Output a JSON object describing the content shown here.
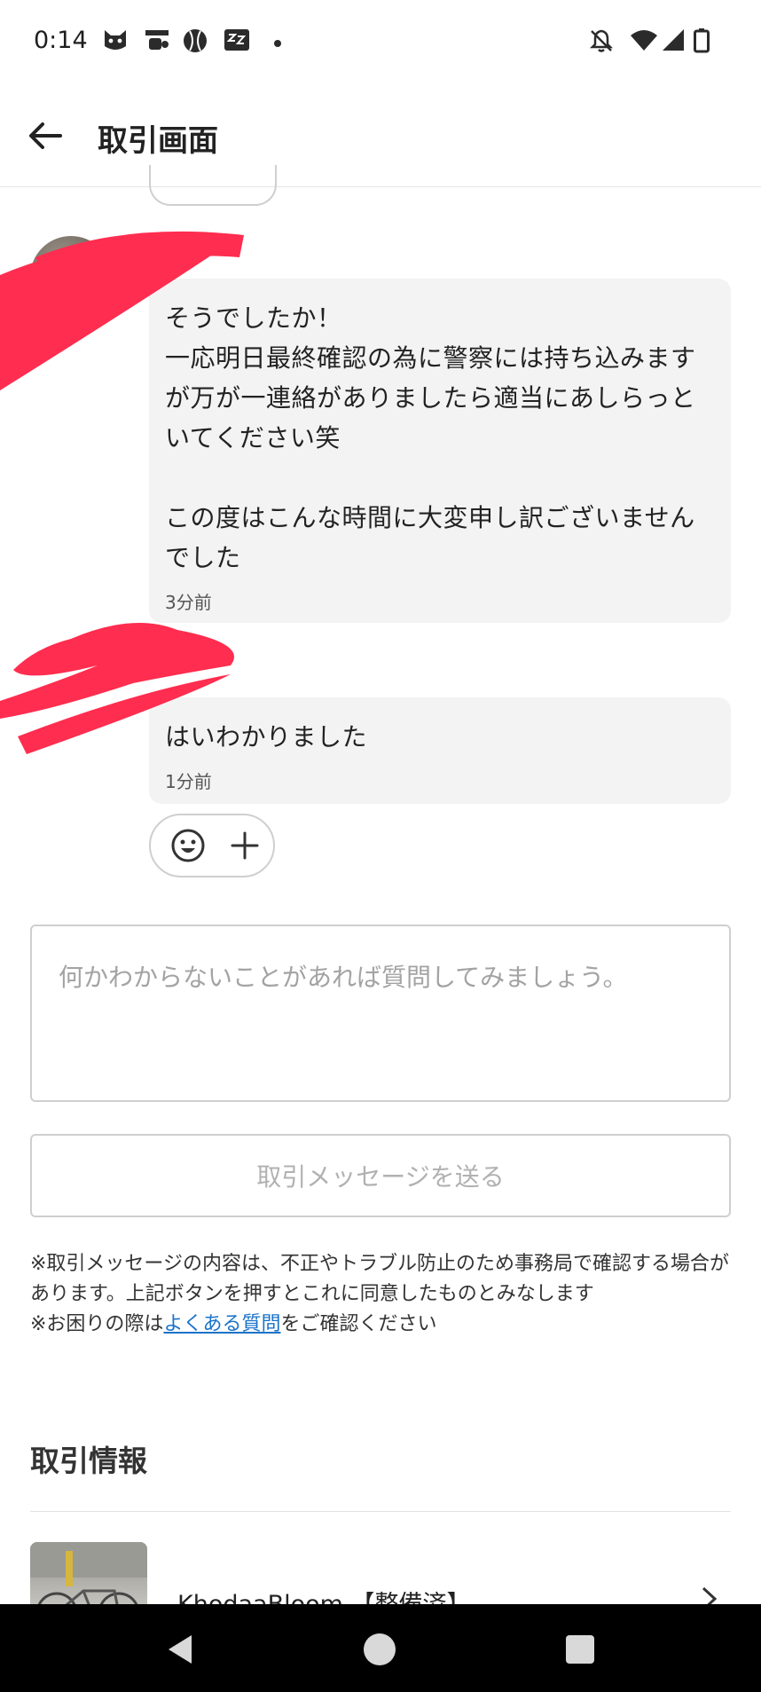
{
  "status_bar": {
    "time": "0:14",
    "notification_icons": [
      "cat-icon",
      "app-icon",
      "ball-icon",
      "zzz-icon",
      "dot-icon"
    ],
    "system_icons": [
      "bell-off-icon",
      "wifi-icon",
      "signal-icon",
      "battery-icon"
    ]
  },
  "header": {
    "title": "取引画面",
    "back_icon": "arrow-left-icon"
  },
  "messages": [
    {
      "text": "そうでしたか！\n一応明日最終確認の為に警察には持ち込みますが万が一連絡がありましたら適当にあしらっといてください笑\n\nこの度はこんな時間に大変申し訳ございませんでした",
      "time": "3分前"
    },
    {
      "text": "はいわかりました",
      "time": "1分前"
    }
  ],
  "reactions": {
    "smile_icon": "smile-icon",
    "add_icon": "plus-icon"
  },
  "compose": {
    "placeholder": "何かわからないことがあれば質問してみましょう。",
    "send_label": "取引メッセージを送る"
  },
  "notice": {
    "line1": "※取引メッセージの内容は、不正やトラブル防止のため事務局で確認する場合があります。上記ボタンを押すとこれに同意したものとみなします",
    "line2_prefix": "※お困りの際は",
    "line2_link": "よくある質問",
    "line2_suffix": "をご確認ください"
  },
  "transaction_info": {
    "heading": "取引情報",
    "product_title": "KhodaaBloom 【整備済】"
  },
  "colors": {
    "bubble_bg": "#f3f3f4",
    "link": "#1a73c9",
    "redaction": "#ff2d4f",
    "nav_bg": "#000000"
  }
}
